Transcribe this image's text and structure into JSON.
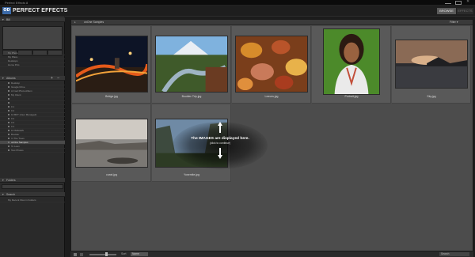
{
  "window": {
    "title": "Perfect Effects 8"
  },
  "header": {
    "logo": "OD",
    "app_name": "PERFECT EFFECTS",
    "mode_browse": "BROWSE",
    "mode_effects": "EFFECTS"
  },
  "sidebar": {
    "browse_section": "Bill",
    "recent_items": [
      "My Photo",
      "My Place",
      "Desktops",
      "Home Pics"
    ],
    "albums_section": "Albums",
    "albums": [
      "Desktop",
      "Google Drive",
      "A Cool Photo Album",
      "My Client",
      "",
      "",
      "0 1",
      "0 2",
      "10 BFT (User Managed)",
      "0 2",
      "0 3",
      "0 4",
      "10 IMAGES",
      "Boulder",
      "In The Trees",
      "onOne Samples",
      "To Lean",
      "Test Photos"
    ],
    "selected_album": "onOne Samples",
    "folders_section": "Folders",
    "search_section": "Search",
    "search_value": "My Recent Files in Folders"
  },
  "browser": {
    "folder_name": "onOne Samples",
    "filter_label": "Filter ▾",
    "images": [
      {
        "name": "Bridge.jpg"
      },
      {
        "name": "Boulder-Trip.jpg"
      },
      {
        "name": "Leaves.jpg"
      },
      {
        "name": "Portrait.jpg"
      },
      {
        "name": "Sky.jpg"
      },
      {
        "name": "coast.jpg"
      },
      {
        "name": "Yosemite.jpg"
      }
    ]
  },
  "help_overlay": {
    "title": "The IMAGES are displayed here.",
    "subtitle": "(click to continue)"
  },
  "bottombar": {
    "sort_label": "Sort",
    "sort_value": "Name",
    "search_placeholder": "Search"
  },
  "colors": {
    "accent": "#3b6aa8",
    "panel_bg": "#4c4c4c",
    "cell_bg": "#595959"
  }
}
